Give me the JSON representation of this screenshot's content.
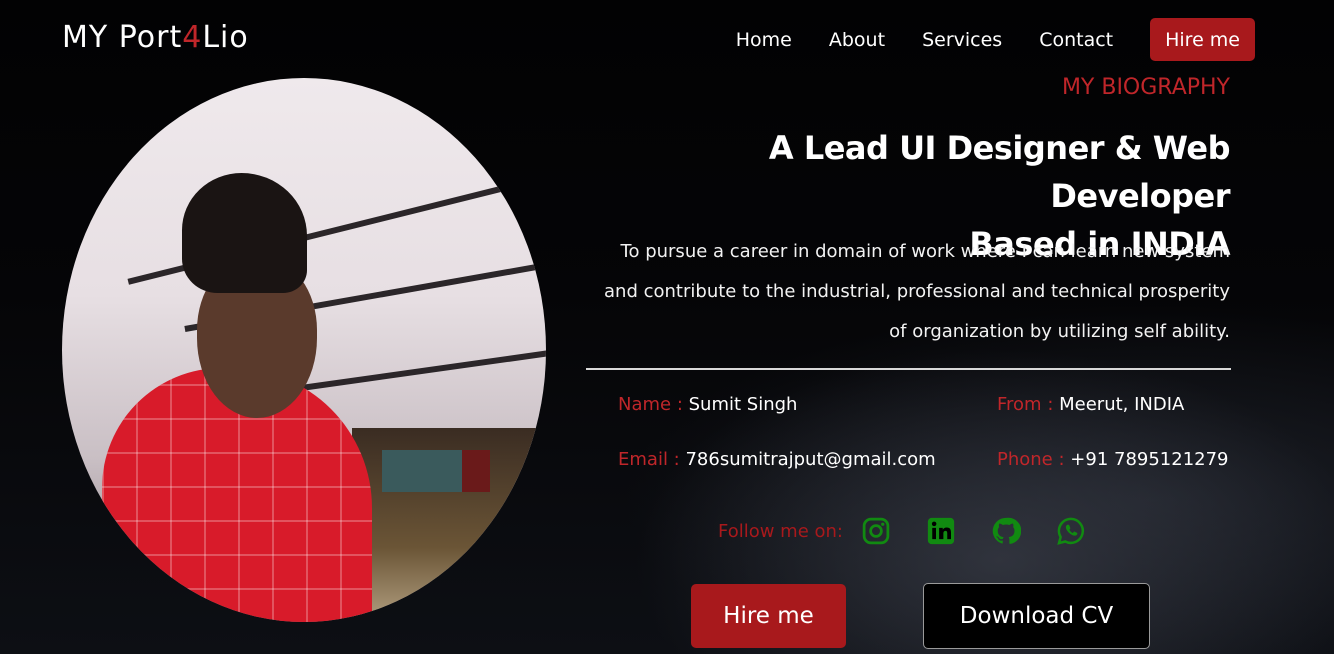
{
  "logo": {
    "part1": "MY Port",
    "accent": "4",
    "part2": "Lio"
  },
  "nav": {
    "items": [
      "Home",
      "About",
      "Services",
      "Contact"
    ],
    "hire_label": "Hire me"
  },
  "bio": {
    "section_title": "MY BIOGRAPHY",
    "headline_line1": "A Lead UI Designer & Web Developer",
    "headline_line2": "Based in INDIA",
    "objective_line1": "To pursue a career in domain of work where I can learn new system",
    "objective_line2": "and contribute to the industrial, professional and technical prosperity",
    "objective_line3": "of organization by utilizing self ability."
  },
  "info": {
    "name_label": "Name :",
    "name_value": "Sumit Singh",
    "from_label": "From :",
    "from_value": "Meerut, INDIA",
    "email_label": "Email :",
    "email_value": "786sumitrajput@gmail.com",
    "phone_label": "Phone :",
    "phone_value": "+91 7895121279"
  },
  "social": {
    "label": "Follow me on:",
    "icons": [
      "instagram-icon",
      "linkedin-icon",
      "github-icon",
      "whatsapp-icon"
    ],
    "icon_color": "#118a11"
  },
  "cta": {
    "hire_label": "Hire me",
    "cv_label": "Download CV"
  },
  "colors": {
    "accent": "#c0262a",
    "button_bg": "#a8191c",
    "background": "#020203"
  }
}
